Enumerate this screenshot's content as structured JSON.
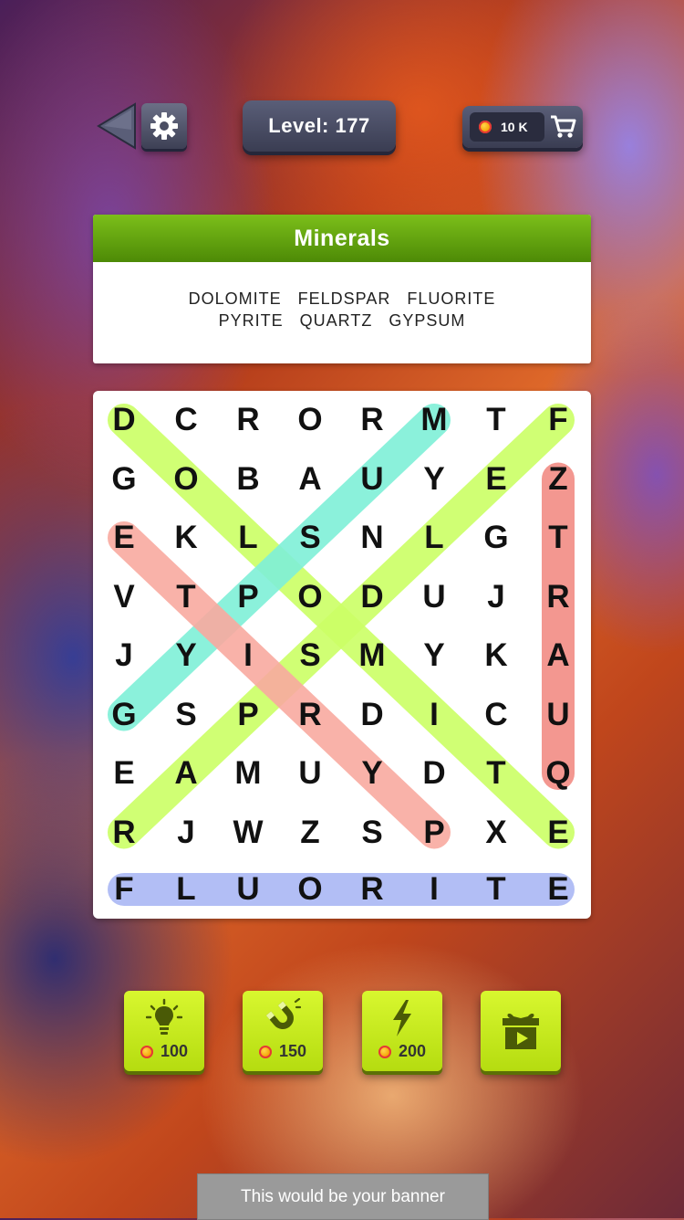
{
  "topbar": {
    "back_icon": "back-arrow-icon",
    "settings_icon": "gear-icon",
    "level_label": "Level: 177",
    "coins_label": "10 K",
    "cart_icon": "cart-icon"
  },
  "category": {
    "title": "Minerals",
    "words_row1": [
      "DOLOMITE",
      "FELDSPAR",
      "FLUORITE"
    ],
    "words_row2": [
      "PYRITE",
      "QUARTZ",
      "GYPSUM"
    ]
  },
  "grid": {
    "rows": [
      [
        "D",
        "C",
        "R",
        "O",
        "R",
        "M",
        "T",
        "F"
      ],
      [
        "G",
        "O",
        "B",
        "A",
        "U",
        "Y",
        "E",
        "Z"
      ],
      [
        "E",
        "K",
        "L",
        "S",
        "N",
        "L",
        "G",
        "T"
      ],
      [
        "V",
        "T",
        "P",
        "O",
        "D",
        "U",
        "J",
        "R"
      ],
      [
        "J",
        "Y",
        "I",
        "S",
        "M",
        "Y",
        "K",
        "A"
      ],
      [
        "G",
        "S",
        "P",
        "R",
        "D",
        "I",
        "C",
        "U"
      ],
      [
        "E",
        "A",
        "M",
        "U",
        "Y",
        "D",
        "T",
        "Q"
      ],
      [
        "R",
        "J",
        "W",
        "Z",
        "S",
        "P",
        "X",
        "E"
      ]
    ],
    "answer_row": [
      "F",
      "L",
      "U",
      "O",
      "R",
      "I",
      "T",
      "E"
    ]
  },
  "found_words": [
    {
      "word": "DOLOMITE",
      "color": "#ccff66",
      "from": [
        0,
        0
      ],
      "to": [
        7,
        7
      ]
    },
    {
      "word": "FELDSPAR",
      "color": "#ccff66",
      "from": [
        0,
        7
      ],
      "to": [
        7,
        0
      ]
    },
    {
      "word": "GYPSUM",
      "color": "#7ff0d8",
      "from": [
        5,
        0
      ],
      "to": [
        0,
        5
      ]
    },
    {
      "word": "PYRITE",
      "color": "#f9aaa0",
      "from": [
        7,
        5
      ],
      "to": [
        2,
        0
      ]
    },
    {
      "word": "QUARTZ",
      "color": "#f28c84",
      "from": [
        6,
        7
      ],
      "to": [
        1,
        7
      ]
    },
    {
      "word": "FLUORITE",
      "color": "#aab8f5",
      "from": [
        8,
        0
      ],
      "to": [
        8,
        7
      ]
    }
  ],
  "powerups": [
    {
      "icon": "lightbulb-icon",
      "price": "100"
    },
    {
      "icon": "magnet-icon",
      "price": "150"
    },
    {
      "icon": "lightning-icon",
      "price": "200"
    },
    {
      "icon": "gift-video-icon",
      "price": ""
    }
  ],
  "banner": {
    "text": "This would be your banner"
  },
  "colors": {
    "accent_green": "#6aaa10",
    "powerup_yellow": "#c9ec1e",
    "panel_dark": "#3a3d52"
  }
}
